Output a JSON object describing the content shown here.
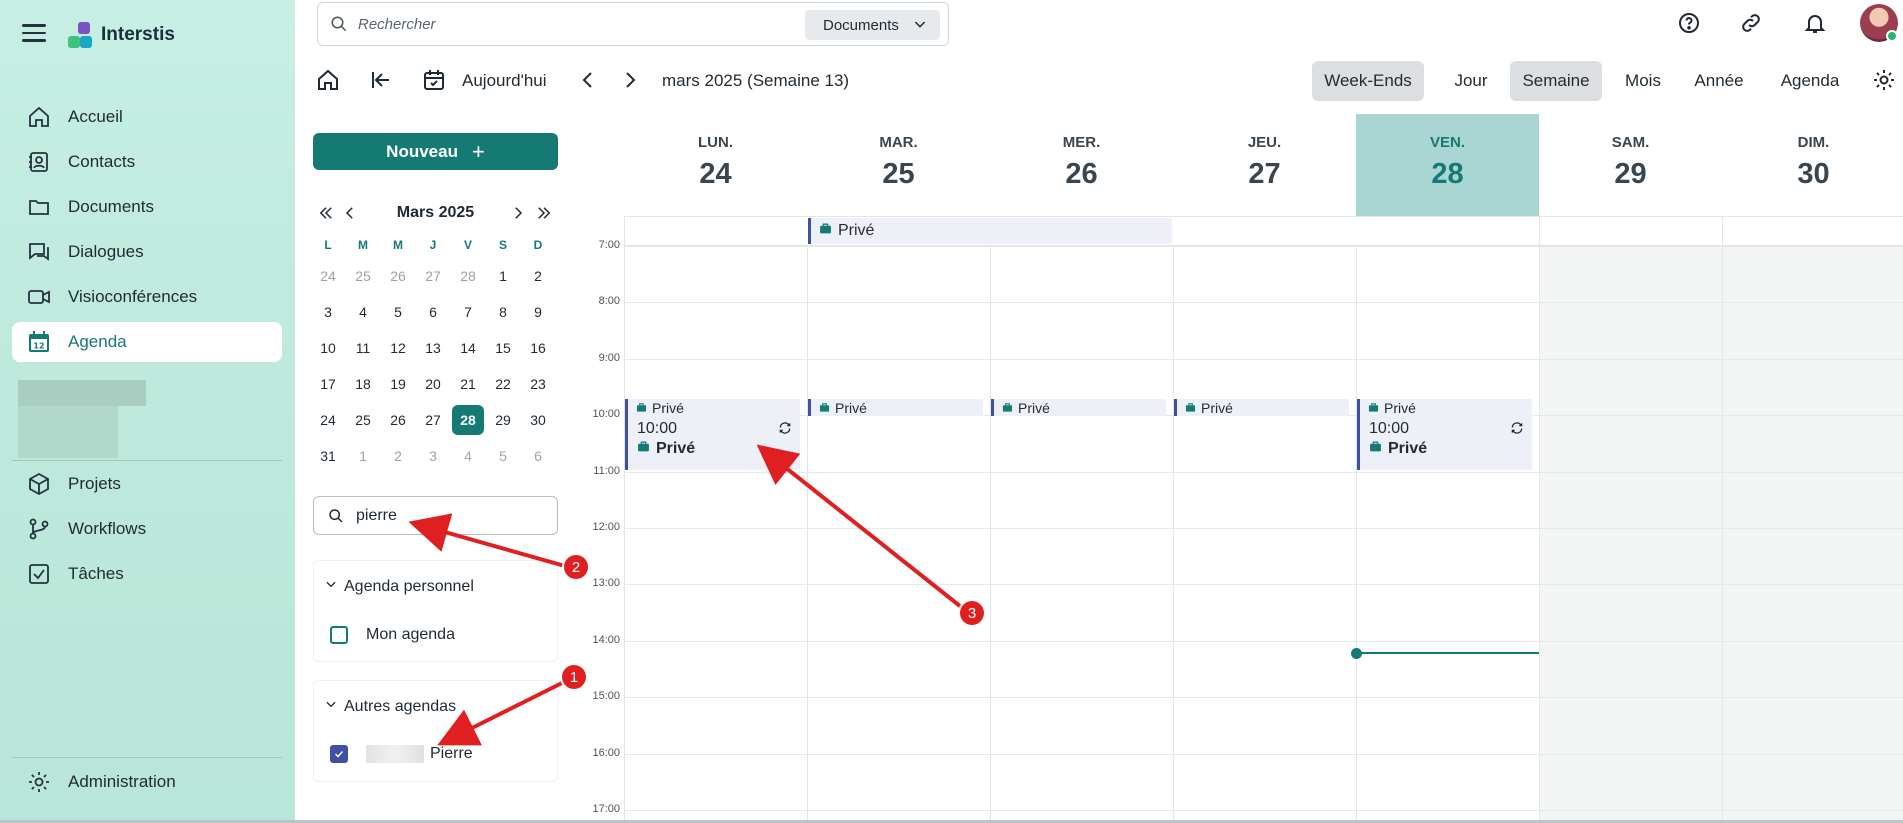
{
  "app": {
    "name": "Interstis"
  },
  "sidebar": {
    "items": [
      {
        "label": "Accueil",
        "icon": "home-icon"
      },
      {
        "label": "Contacts",
        "icon": "contacts-icon"
      },
      {
        "label": "Documents",
        "icon": "folder-icon"
      },
      {
        "label": "Dialogues",
        "icon": "chat-icon"
      },
      {
        "label": "Visioconférences",
        "icon": "video-icon"
      },
      {
        "label": "Agenda",
        "icon": "calendar-icon",
        "active": true
      }
    ],
    "items2": [
      {
        "label": "Projets",
        "icon": "cube-icon"
      },
      {
        "label": "Workflows",
        "icon": "branch-icon"
      },
      {
        "label": "Tâches",
        "icon": "checkbox-icon"
      }
    ],
    "admin_label": "Administration"
  },
  "search": {
    "placeholder": "Rechercher",
    "scope": "Documents"
  },
  "toolbar": {
    "today_label": "Aujourd'hui",
    "period_label": "mars 2025 (Semaine 13)",
    "views": [
      "Week-Ends",
      "Jour",
      "Semaine",
      "Mois",
      "Année",
      "Agenda"
    ],
    "selected_view": "Semaine"
  },
  "left": {
    "new_label": "Nouveau",
    "mini_cal": {
      "title": "Mars 2025",
      "dow": [
        "L",
        "M",
        "M",
        "J",
        "V",
        "S",
        "D"
      ],
      "weeks": [
        [
          "24",
          "25",
          "26",
          "27",
          "28",
          "1",
          "2"
        ],
        [
          "3",
          "4",
          "5",
          "6",
          "7",
          "8",
          "9"
        ],
        [
          "10",
          "11",
          "12",
          "13",
          "14",
          "15",
          "16"
        ],
        [
          "17",
          "18",
          "19",
          "20",
          "21",
          "22",
          "23"
        ],
        [
          "24",
          "25",
          "26",
          "27",
          "28",
          "29",
          "30"
        ],
        [
          "31",
          "1",
          "2",
          "3",
          "4",
          "5",
          "6"
        ]
      ],
      "today": "28"
    },
    "filter_value": "pierre",
    "group1": {
      "title": "Agenda personnel",
      "items": [
        {
          "label": "Mon agenda",
          "checked": false
        }
      ]
    },
    "group2": {
      "title": "Autres agendas",
      "items": [
        {
          "label": "Pierre",
          "checked": true
        }
      ]
    }
  },
  "calendar": {
    "days": [
      {
        "name": "LUN.",
        "num": "24"
      },
      {
        "name": "MAR.",
        "num": "25"
      },
      {
        "name": "MER.",
        "num": "26"
      },
      {
        "name": "JEU.",
        "num": "27"
      },
      {
        "name": "VEN.",
        "num": "28",
        "current": true
      },
      {
        "name": "SAM.",
        "num": "29"
      },
      {
        "name": "DIM.",
        "num": "30"
      }
    ],
    "hours": [
      "7:00",
      "8:00",
      "9:00",
      "10:00",
      "11:00",
      "12:00",
      "13:00",
      "14:00",
      "15:00",
      "16:00",
      "17:00"
    ],
    "allday_event": "Privé",
    "bar_event": "Privé",
    "block_event": {
      "time": "10:00",
      "label": "Privé"
    }
  },
  "annotations": [
    "1",
    "2",
    "3"
  ],
  "colors": {
    "accent": "#157a74",
    "event_border": "#3f4fa3",
    "annotation": "#e02020"
  }
}
